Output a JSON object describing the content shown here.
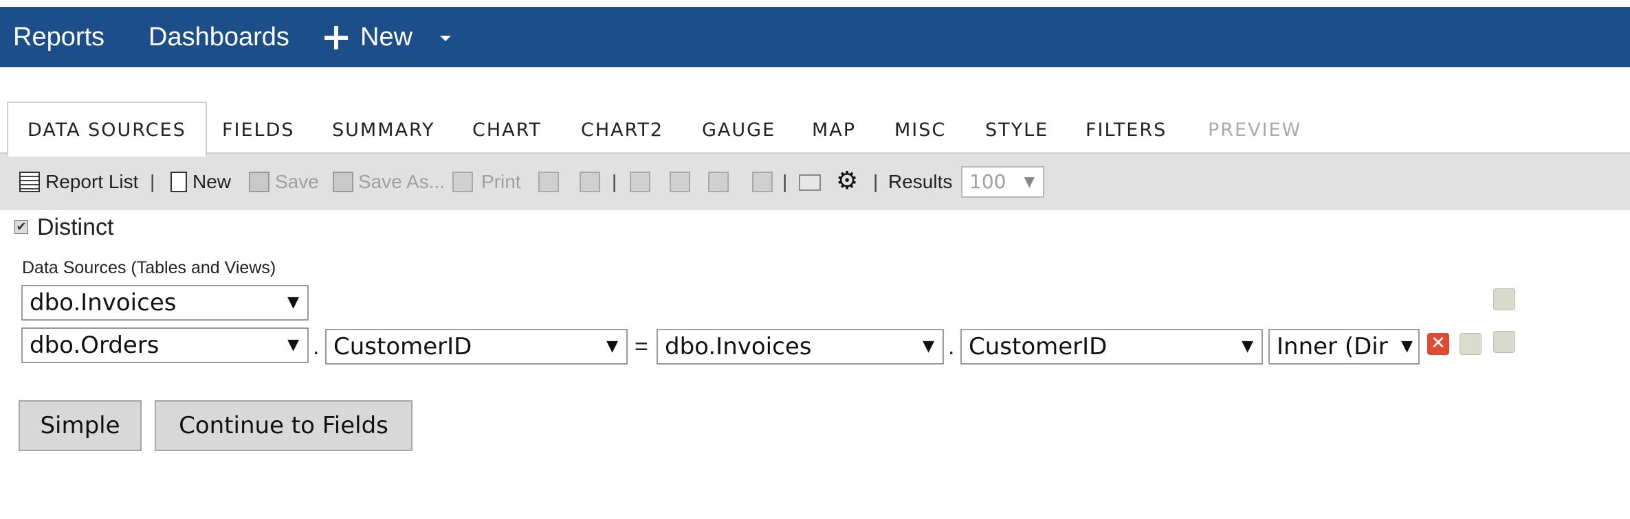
{
  "nav": {
    "reports": "Reports",
    "dashboards": "Dashboards",
    "new": "New"
  },
  "tabs": [
    "DATA SOURCES",
    "FIELDS",
    "SUMMARY",
    "CHART",
    "CHART2",
    "GAUGE",
    "MAP",
    "MISC",
    "STYLE",
    "FILTERS",
    "PREVIEW"
  ],
  "toolbar": {
    "report_list": "Report List",
    "new": "New",
    "save": "Save",
    "save_as": "Save As...",
    "print": "Print",
    "results_label": "Results",
    "results_value": "100",
    "separator": "|"
  },
  "distinct": {
    "label": "Distinct",
    "checked": true,
    "check_mark": "✔"
  },
  "sources": {
    "heading": "Data Sources (Tables and Views)",
    "row1": {
      "table": "dbo.Invoices"
    },
    "row2": {
      "table": "dbo.Orders",
      "left_field": "CustomerID",
      "operator": "=",
      "right_table": "dbo.Invoices",
      "right_field": "CustomerID",
      "join": "Inner (Dir",
      "dot": "."
    }
  },
  "buttons": {
    "simple": "Simple",
    "continue": "Continue to Fields"
  },
  "colors": {
    "nav_bg": "#1c4f8a",
    "toolbar_bg": "#e1e1e1",
    "delete_icon": "#e04a32"
  }
}
